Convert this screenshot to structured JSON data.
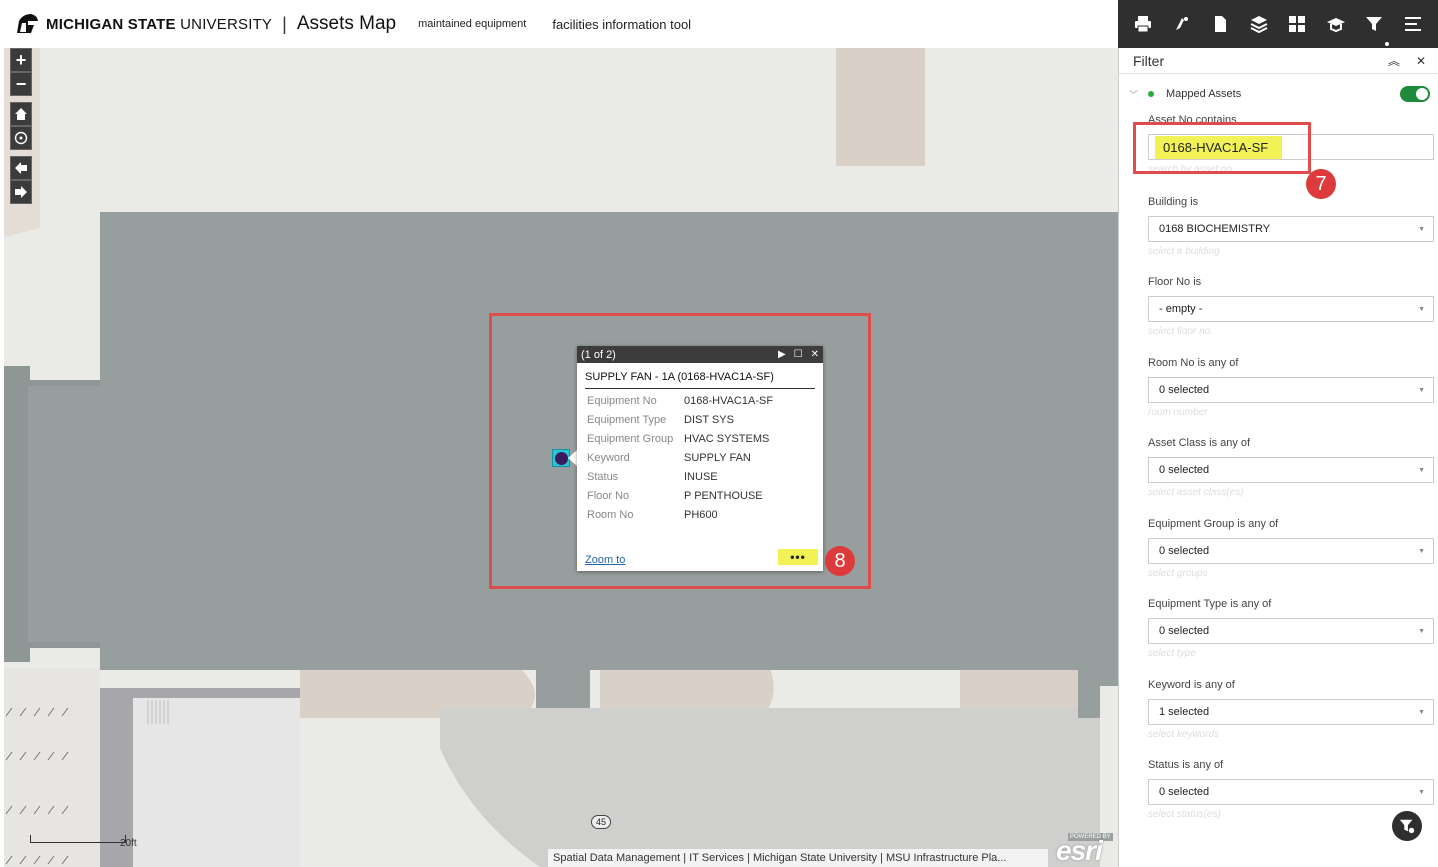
{
  "header": {
    "brand_bold": "MICHIGAN STATE",
    "brand_light": "UNIVERSITY",
    "separator": "|",
    "app_title": "Assets Map",
    "links": [
      "maintained equipment",
      "facilities information tool"
    ]
  },
  "map": {
    "controls": {
      "zoom_in": "+",
      "zoom_out": "−"
    },
    "scale_label": "20ft",
    "road_number": "45",
    "attribution": "Spatial Data Management | IT Services | Michigan State University | MSU Infrastructure Pla...",
    "esri_powered": "POWERED BY",
    "esri_logo": "esri"
  },
  "popup": {
    "count": "(1 of 2)",
    "title": "SUPPLY FAN - 1A (0168-HVAC1A-SF)",
    "attributes": [
      {
        "key": "Equipment No",
        "value": "0168-HVAC1A-SF"
      },
      {
        "key": "Equipment Type",
        "value": "DIST SYS"
      },
      {
        "key": "Equipment Group",
        "value": "HVAC SYSTEMS"
      },
      {
        "key": "Keyword",
        "value": "SUPPLY FAN"
      },
      {
        "key": "Status",
        "value": "INUSE"
      },
      {
        "key": "Floor No",
        "value": "P PENTHOUSE"
      },
      {
        "key": "Room No",
        "value": "PH600"
      }
    ],
    "zoom_to": "Zoom to",
    "more": "•••"
  },
  "annotations": {
    "step7": "7",
    "step8": "8"
  },
  "panel": {
    "title": "Filter",
    "layer_name": "Mapped Assets",
    "fields": [
      {
        "label": "Asset No contains",
        "value": "0168-HVAC1A-SF",
        "hint": "search by asset no"
      },
      {
        "label": "Building is",
        "value": "0168 BIOCHEMISTRY",
        "hint": "select a building"
      },
      {
        "label": "Floor No is",
        "value": "- empty -",
        "hint": "select floor no."
      },
      {
        "label": "Room No is any of",
        "value": "0 selected",
        "hint": "room number"
      },
      {
        "label": "Asset Class is any of",
        "value": "0 selected",
        "hint": "select asset class(es)"
      },
      {
        "label": "Equipment Group is any of",
        "value": "0 selected",
        "hint": "select groups"
      },
      {
        "label": "Equipment Type is any of",
        "value": "0 selected",
        "hint": "select type"
      },
      {
        "label": "Keyword is any of",
        "value": "1 selected",
        "hint": "select keywords"
      },
      {
        "label": "Status is any of",
        "value": "0 selected",
        "hint": "select status(es)"
      }
    ]
  },
  "colors": {
    "highlight": "#f2f256",
    "annotation_red": "#dd3b3b",
    "toolbar_bg": "#2f2f2f",
    "building_fill": "#979e9e",
    "toggle_on": "#1f8a3a"
  }
}
